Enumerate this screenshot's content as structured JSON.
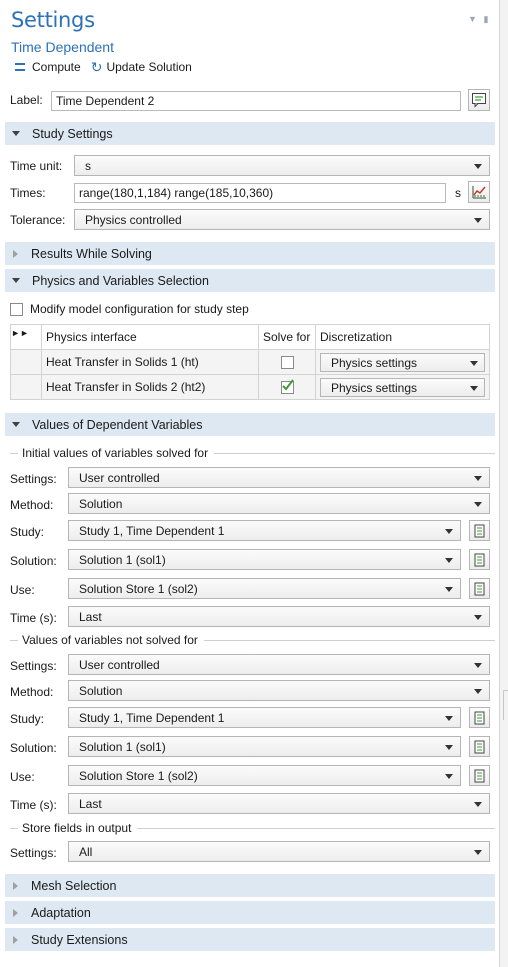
{
  "header": {
    "title": "Settings",
    "subtitle": "Time Dependent",
    "compute_label": "Compute",
    "update_label": "Update Solution"
  },
  "label_field": {
    "label": "Label:",
    "value": "Time Dependent 2"
  },
  "sections": {
    "study_settings": "Study Settings",
    "results_while_solving": "Results While Solving",
    "physics_selection": "Physics and Variables Selection",
    "dependent_values": "Values of Dependent Variables",
    "mesh_selection": "Mesh Selection",
    "adaptation": "Adaptation",
    "study_extensions": "Study Extensions"
  },
  "study_settings": {
    "time_unit_label": "Time unit:",
    "time_unit_value": "s",
    "times_label": "Times:",
    "times_value": "range(180,1,184) range(185,10,360)",
    "times_unit": "s",
    "tolerance_label": "Tolerance:",
    "tolerance_value": "Physics controlled"
  },
  "physics": {
    "modify_label": "Modify model configuration for study step",
    "modify_checked": false,
    "columns": [
      "Physics interface",
      "Solve for",
      "Discretization"
    ],
    "rows": [
      {
        "name": "Heat Transfer in Solids 1 (ht)",
        "solve": false,
        "disc": "Physics settings"
      },
      {
        "name": "Heat Transfer in Solids 2 (ht2)",
        "solve": true,
        "disc": "Physics settings"
      }
    ]
  },
  "initial_values": {
    "group_title": "Initial values of variables solved for",
    "settings_label": "Settings:",
    "settings_value": "User controlled",
    "method_label": "Method:",
    "method_value": "Solution",
    "study_label": "Study:",
    "study_value": "Study 1, Time Dependent 1",
    "solution_label": "Solution:",
    "solution_value": "Solution 1 (sol1)",
    "use_label": "Use:",
    "use_value": "Solution Store 1 (sol2)",
    "time_label": "Time (s):",
    "time_value": "Last"
  },
  "not_solved_values": {
    "group_title": "Values of variables not solved for",
    "settings_label": "Settings:",
    "settings_value": "User controlled",
    "method_label": "Method:",
    "method_value": "Solution",
    "study_label": "Study:",
    "study_value": "Study 1, Time Dependent 1",
    "solution_label": "Solution:",
    "solution_value": "Solution 1 (sol1)",
    "use_label": "Use:",
    "use_value": "Solution Store 1 (sol2)",
    "time_label": "Time (s):",
    "time_value": "Last"
  },
  "store_fields": {
    "group_title": "Store fields in output",
    "settings_label": "Settings:",
    "settings_value": "All"
  },
  "colors": {
    "accent": "#2d72b8",
    "section_bg": "#dde8f2",
    "check_green": "#3f9b35"
  }
}
